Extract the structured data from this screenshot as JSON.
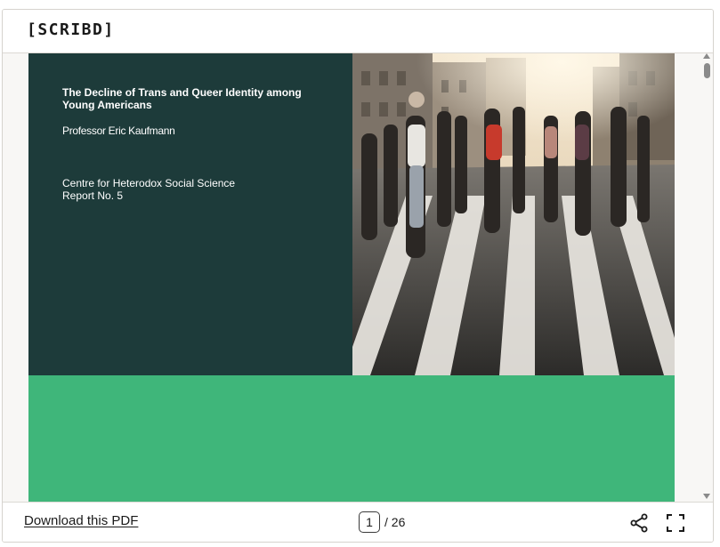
{
  "header": {
    "logo": "[SCRIBD]"
  },
  "document": {
    "title": "The Decline of Trans and Queer Identity among Young Americans",
    "author": "Professor Eric Kaufmann",
    "organization": "Centre for Heterodox Social Science",
    "report": "Report No. 5",
    "photo_description": "pedestrians-crossing-street-photo",
    "cover_dark_color": "#1d3b3a",
    "band_color": "#3fb67a"
  },
  "footer": {
    "download_label": "Download this PDF",
    "current_page": "1",
    "page_separator": "/ 26",
    "share_icon": "share-icon",
    "fullscreen_icon": "fullscreen-icon"
  }
}
